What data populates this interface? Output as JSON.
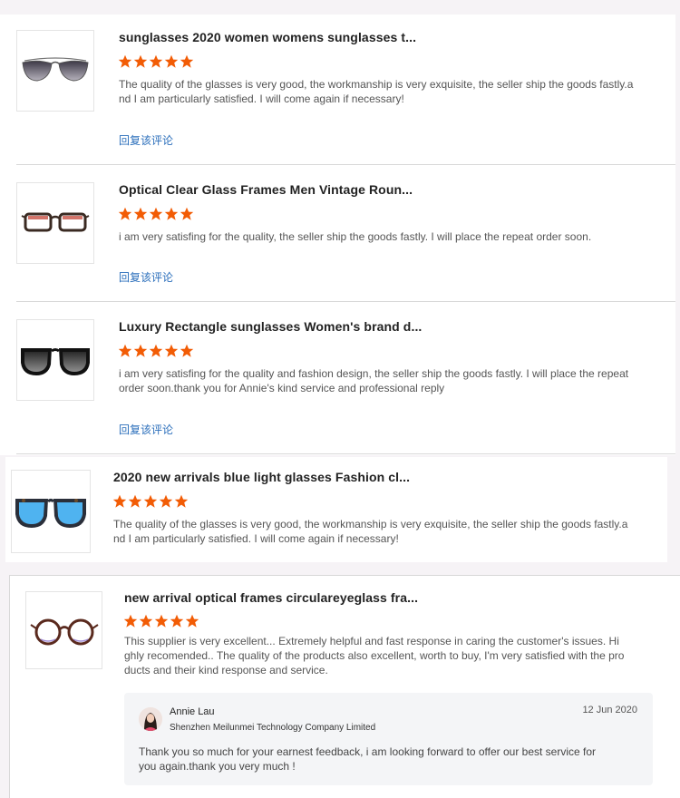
{
  "reviews": [
    {
      "title": "sunglasses 2020 women womens sunglasses t...",
      "rating": 5,
      "text": "The quality of the glasses is very good, the workmanship is very exquisite, the seller ship the goods fastly.and I am particularly satisfied. I will come again if necessary!",
      "reply_label": "回复该评论",
      "product_icon": "aviator-sunglasses-icon"
    },
    {
      "title": "Optical Clear Glass Frames Men Vintage Roun...",
      "rating": 5,
      "text": "i am very satisfing for the quality, the seller ship the goods fastly. I will place the repeat order soon.",
      "reply_label": "回复该评论",
      "product_icon": "tortoise-optical-frames-icon"
    },
    {
      "title": "Luxury Rectangle sunglasses Women's brand d...",
      "rating": 5,
      "text": "i am very satisfing for the quality and fashion design, the seller ship the goods fastly. I will place the repeat order soon.thank you for Annie's kind service and professional reply",
      "reply_label": "回复该评论",
      "product_icon": "black-sunglasses-icon"
    },
    {
      "title": "2020 new arrivals blue light glasses Fashion cl...",
      "rating": 5,
      "text": "The quality of the glasses is very good, the workmanship is very exquisite, the seller ship the goods fastly.and I am particularly satisfied. I will come again if necessary!",
      "product_icon": "blue-lens-glasses-icon"
    },
    {
      "title": "new arrival optical frames circulareyeglass fra...",
      "rating": 5,
      "text": "This supplier is very excellent... Extremely helpful and fast response in caring the customer's issues. Highly recomended.. The quality of the products also excellent, worth to buy, I'm very satisfied with the products and their kind response and service.",
      "product_icon": "round-eyeglasses-icon",
      "seller_reply": {
        "name": "Annie Lau",
        "company": "Shenzhen Meilunmei Technology Company Limited",
        "date": "12 Jun 2020",
        "text": "Thank you so much for your earnest feedback, i am looking forward to offer our best service for you again.thank you very much !"
      }
    }
  ],
  "colors": {
    "star": "#f25c05",
    "link": "#2a6ebb",
    "blue_lens": "#4fb3f0"
  }
}
